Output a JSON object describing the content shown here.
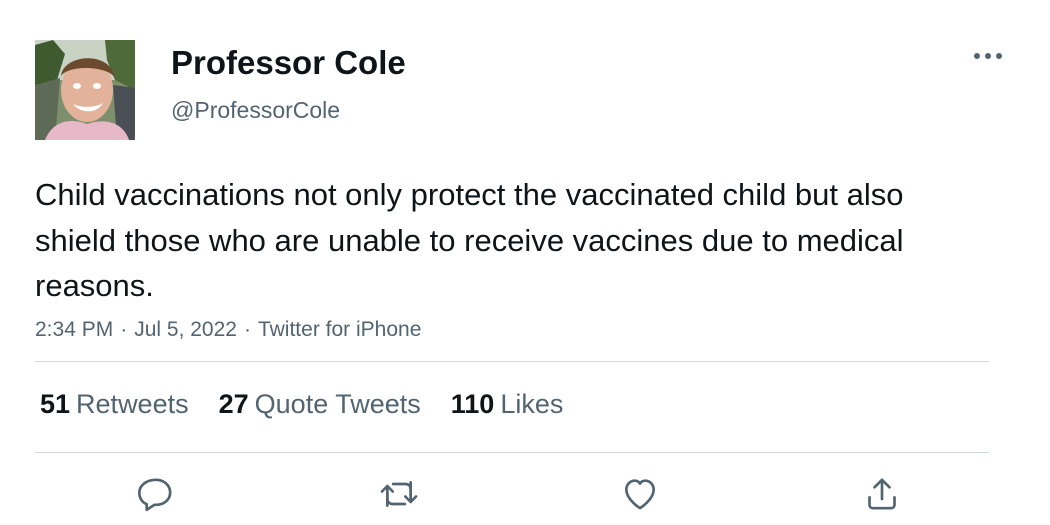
{
  "user": {
    "display_name": "Professor Cole",
    "handle": "@ProfessorCole",
    "avatar": "profile-photo"
  },
  "more_icon": "more-dots-icon",
  "tweet": {
    "text": "Child vaccinations not only protect the vaccinated child but also shield those who are unable to receive vaccines due to medical reasons."
  },
  "meta": {
    "time": "2:34 PM",
    "date": "Jul 5, 2022",
    "source": "Twitter for iPhone",
    "separator": "·"
  },
  "stats": {
    "retweets": {
      "count": "51",
      "label": "Retweets"
    },
    "quotes": {
      "count": "27",
      "label": "Quote Tweets"
    },
    "likes": {
      "count": "110",
      "label": "Likes"
    }
  },
  "actions": [
    {
      "icon": "reply-icon"
    },
    {
      "icon": "retweet-icon"
    },
    {
      "icon": "like-icon"
    },
    {
      "icon": "share-icon"
    }
  ],
  "colors": {
    "text_primary": "#0f1419",
    "text_secondary": "#536471",
    "divider": "#cfd9de"
  }
}
